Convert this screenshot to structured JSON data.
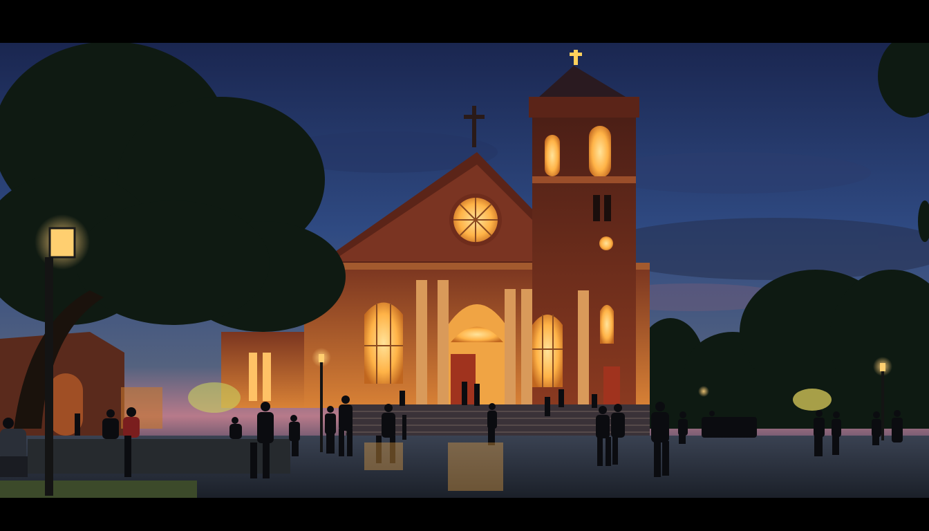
{
  "image": {
    "description_tags": [
      "church",
      "bell-tower",
      "plaza",
      "dusk",
      "street-lamps",
      "trees",
      "people"
    ],
    "palette": {
      "sky_top": "#1c2a52",
      "sky_mid": "#33508a",
      "sky_horizon": "#c97f8a",
      "brick": "#6b2a1c",
      "glow": "#ffb347",
      "plaza": "#2c3340",
      "foliage": "#0f1a12"
    }
  }
}
